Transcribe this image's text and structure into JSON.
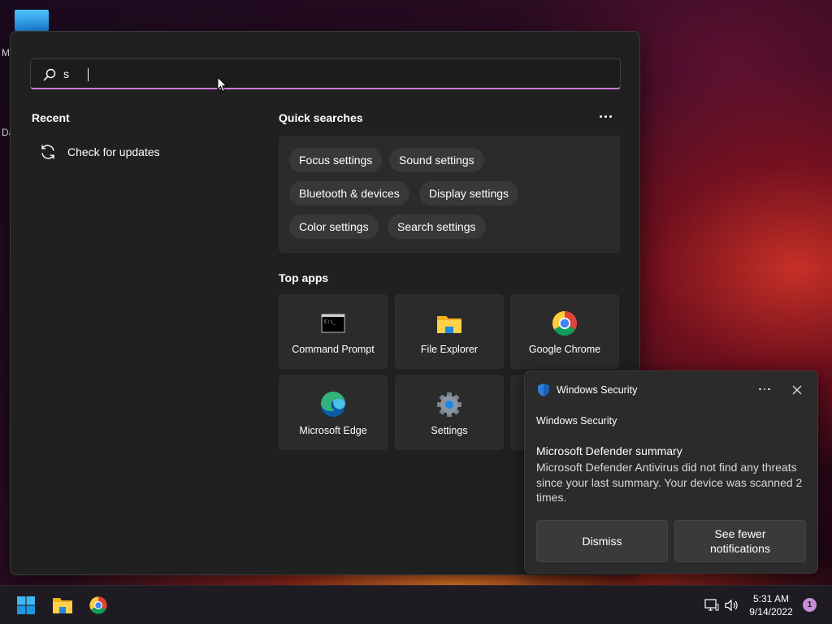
{
  "desktop": {
    "labels": [
      "M",
      "Da"
    ]
  },
  "search": {
    "value": "s",
    "placeholder": ""
  },
  "recent": {
    "title": "Recent",
    "items": [
      {
        "label": "Check for updates",
        "icon": "refresh-icon"
      }
    ]
  },
  "quick_searches": {
    "title": "Quick searches",
    "chips": [
      "Focus settings",
      "Sound settings",
      "Bluetooth & devices",
      "Display settings",
      "Color settings",
      "Search settings"
    ]
  },
  "top_apps": {
    "title": "Top apps",
    "apps": [
      {
        "label": "Command Prompt",
        "icon": "command-prompt-icon"
      },
      {
        "label": "File Explorer",
        "icon": "folder-icon"
      },
      {
        "label": "Google Chrome",
        "icon": "chrome-icon"
      },
      {
        "label": "Microsoft Edge",
        "icon": "edge-icon"
      },
      {
        "label": "Settings",
        "icon": "gear-icon"
      }
    ]
  },
  "notification": {
    "app_name": "Windows Security",
    "subtitle": "Windows Security",
    "headline": "Microsoft Defender summary",
    "body": "Microsoft Defender Antivirus did not find any threats since your last summary. Your device was scanned 2 times.",
    "dismiss_label": "Dismiss",
    "fewer_label_line1": "See fewer",
    "fewer_label_line2": "notifications"
  },
  "taskbar": {
    "time": "5:31 AM",
    "date": "9/14/2022",
    "notification_count": "1",
    "pinned": [
      "windows-start-icon",
      "file-explorer-icon",
      "chrome-icon"
    ]
  },
  "colors": {
    "accent": "#c87dd4",
    "panel": "#202020",
    "tile": "#2b2b2b",
    "chip": "#383838"
  }
}
